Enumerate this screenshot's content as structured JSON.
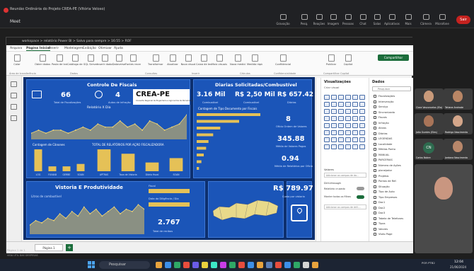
{
  "meeting": {
    "title": "Reunião Ordinária do Projeto CREA-PE (Vitória Veloso)",
    "brand": "Meet",
    "tools": [
      "Gravação",
      "Pesq.",
      "Reações",
      "Imagem",
      "Pessoas",
      "Chat",
      "Salas",
      "Aplicativos",
      "Mais",
      "Câmera",
      "Microfone",
      "Compartilhar"
    ],
    "leave": "Sair"
  },
  "pbi": {
    "titlebar": "workspace > relatório Power BI > Salvo para sempre > 16:55 > ROF",
    "menus": [
      "Arquivo",
      "Página Inicial",
      "Inserir",
      "Modelagem",
      "Exibição",
      "Otimizar",
      "Ajuda"
    ],
    "active_menu": "Página Inicial",
    "share": "Compartilhar",
    "ribbon_buttons": [
      "Colar",
      "Obter dados",
      "Pasta de trabalho do Excel",
      "Catálogo de Dados",
      "SQL Server",
      "Inserir dados",
      "Dataverse",
      "Fontes recentes",
      "Transformar dados",
      "Atualizar",
      "Novo visual",
      "Caixa de texto",
      "Mais visuais",
      "Nova medida",
      "Medida rápida",
      "Confidencialidade",
      "Publicar",
      "Copilot"
    ],
    "ribbon_groups": [
      "Área de transferência",
      "Dados",
      "Consultas",
      "Inserir",
      "Cálculos",
      "Confidencialidade",
      "Compartilhar",
      "Copilot"
    ],
    "page_tab": "Página 1",
    "status_page": "Página 1 de 1",
    "status_saved": "VIDA ÚTIL DAS DESPESAS"
  },
  "dashboard": {
    "control": {
      "title": "Controle De Fiscais",
      "fiscais_total": "66",
      "fiscais_total_label": "Total de Fiscalizações",
      "autos": "4",
      "autos_label": "Autos de infração",
      "logo": "CREA-PE",
      "logo_sub": "Conselho Regional de Engenharia e Agronomia de Pernambuco",
      "chart1_title": "Relatório X Dia",
      "chart2_title": "Contagem de Cânones",
      "chart3_title": "TOTAL DE RELATÓRIOS POR AÇÃO FISCALIZADORA"
    },
    "diarias": {
      "title": "Diarias Solicitadas/Combustível",
      "kpi1": "3.16 Mil",
      "kpi1_label": "Combustível",
      "kpi2": "R$ 2,50 Mil",
      "kpi2_label": "Combustível",
      "kpi3": "R$ 657.42",
      "kpi3_label": "Diárias",
      "tipo_title": "Contagem de Tipo Documento por Fiscais",
      "side1": "8",
      "side1_label": "Ofício Ordem de Valores",
      "side2": "345.88",
      "side2_label": "Média de Valores Pagos",
      "side3": "0.94",
      "side3_label": "Média de Relatórios por Ofício"
    },
    "vistoria": {
      "title": "Vistoria E Produtividade",
      "line_label": "Litros de combustível",
      "filter1": "Fiscal",
      "filter2": "Data da Diligência / Dia",
      "kpi": "2.767",
      "kpi_label": "Total de recibos",
      "valor": "R$ 789.97",
      "valor_label": "Custo por vistoria"
    }
  },
  "chart_data": [
    {
      "type": "area",
      "title": "Relatório X Dia",
      "values": [
        2,
        3,
        2,
        3,
        3,
        2,
        3,
        4,
        3,
        5,
        4,
        4,
        6,
        4,
        5,
        3,
        6,
        5,
        3,
        4,
        5,
        8
      ]
    },
    {
      "type": "bar",
      "title": "Contagem de Cânones",
      "categories": [
        "LOG",
        "FUNIAB",
        "GERBE",
        "SOAN"
      ],
      "values": [
        9,
        2,
        2,
        3
      ]
    },
    {
      "type": "bar",
      "title": "TOTAL DE RELATÓRIOS POR AÇÃO FISCALIZADORA",
      "categories": [
        "APTRAS",
        "Taxa de Vistoria",
        "Diário fiscal",
        "SOAN"
      ],
      "values": [
        10,
        8,
        4,
        6
      ]
    },
    {
      "type": "bar",
      "title": "Contagem de Tipo Documento por Fiscais",
      "values": [
        27,
        18,
        10,
        7,
        5,
        4,
        3,
        2,
        1
      ]
    },
    {
      "type": "area",
      "title": "Litros de combustível",
      "values": [
        4,
        6,
        5,
        7,
        6,
        9,
        7,
        10,
        8,
        12,
        9,
        11,
        8,
        10,
        12,
        9,
        11,
        10,
        13,
        11
      ]
    }
  ],
  "panes": {
    "vis_title": "Visualizações",
    "vis_sub": "Criar visual",
    "values_label": "Valores",
    "values_hint": "Adicionar os campos de da...",
    "drill_label": "Drill-through",
    "cross_label": "Relatório cruzado",
    "keep_label": "Manter todos os filtros",
    "drill_hint": "Adicionar os campos de drill-...",
    "data_title": "Dados",
    "search": "Pesquisar",
    "fields": [
      "Fiscalizações",
      "Intervenção",
      "Serviço",
      "Sincronizado",
      "Fiscais",
      "Infração",
      "Ativos",
      "Diárias",
      "LEGENDAS",
      "Localidade",
      "Médias Ponto",
      "MANUAL",
      "PARCERIAS",
      "Número de Ações",
      "planejador",
      "Projetos",
      "Pontos de Ref.",
      "Situação",
      "Tipo de Auto",
      "Tipo Empresas",
      "Doc1",
      "Doc2",
      "Doc3",
      "Tabela de Telefones",
      "Tipos",
      "Valores",
      "Visão Page"
    ]
  },
  "participants": [
    {
      "name": "Clara Vasconcelos (Ela)"
    },
    {
      "name": "Tatiane Andrade"
    },
    {
      "name": "João Guedes (Eles)"
    },
    {
      "name": "Rodrigo Nascimento"
    },
    {
      "name": "CN",
      "label": "Carlos Nobre"
    },
    {
      "name": "Jordana Nascimento"
    }
  ],
  "taskbar": {
    "search": "Pesquisar",
    "lang": "POR PTB2",
    "time": "12:04",
    "date": "21/06/2024"
  }
}
